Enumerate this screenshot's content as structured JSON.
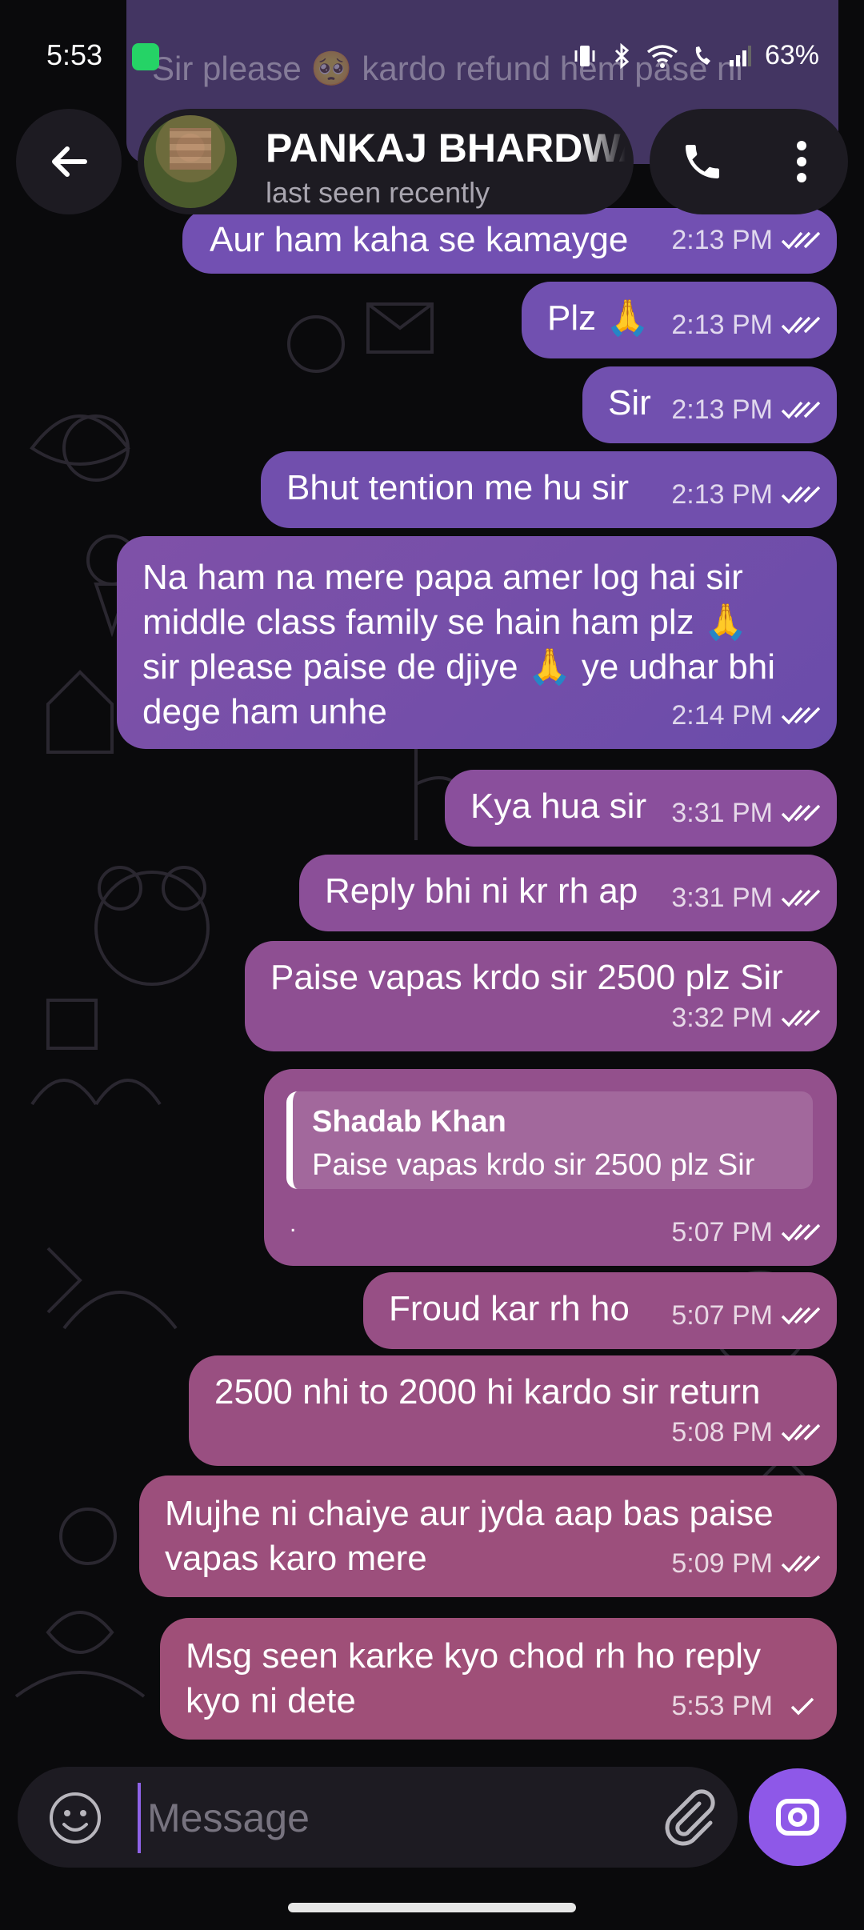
{
  "status_bar": {
    "time": "5:53",
    "battery": "63%"
  },
  "header": {
    "contact_name": "PANKAJ BHARDWAJ",
    "contact_status": "last seen recently"
  },
  "background_preview": "Sir please 🥺 kardo refund hem pase ni",
  "messages": [
    {
      "text": [
        "Aur ham kaha se kamayge"
      ],
      "time": "2:13 PM",
      "status": "read"
    },
    {
      "text": [
        "Plz 🙏"
      ],
      "time": "2:13 PM",
      "status": "read"
    },
    {
      "text": [
        "Sir"
      ],
      "time": "2:13 PM",
      "status": "read"
    },
    {
      "text": [
        "Bhut tention me hu sir"
      ],
      "time": "2:13 PM",
      "status": "read"
    },
    {
      "text": [
        "Na ham na mere papa amer log hai sir",
        "middle class family se hain ham plz 🙏",
        "sir please paise de djiye 🙏 ye udhar bhi",
        "dege ham unhe"
      ],
      "time": "2:14 PM",
      "status": "read"
    },
    {
      "text": [
        "Kya hua sir"
      ],
      "time": "3:31 PM",
      "status": "read"
    },
    {
      "text": [
        "Reply bhi ni kr rh ap"
      ],
      "time": "3:31 PM",
      "status": "read"
    },
    {
      "text": [
        "Paise vapas krdo sir 2500 plz Sir"
      ],
      "time": "3:32 PM",
      "status": "read"
    },
    {
      "reply_to": {
        "author": "Shadab Khan",
        "text": "Paise vapas krdo sir 2500 plz Sir"
      },
      "text": [
        "."
      ],
      "time": "5:07 PM",
      "status": "read"
    },
    {
      "text": [
        "Froud kar rh ho"
      ],
      "time": "5:07 PM",
      "status": "read"
    },
    {
      "text": [
        "2500 nhi to 2000 hi kardo sir return"
      ],
      "time": "5:08 PM",
      "status": "read"
    },
    {
      "text": [
        "Mujhe ni chaiye aur jyda aap bas paise",
        "vapas karo mere"
      ],
      "time": "5:09 PM",
      "status": "read"
    },
    {
      "text": [
        "Msg seen karke kyo chod rh ho reply",
        "kyo ni dete"
      ],
      "time": "5:53 PM",
      "status": "sent"
    }
  ],
  "input": {
    "placeholder": "Message"
  },
  "colors": {
    "accent": "#8e58e8",
    "bubble_top": "#6b4aa6",
    "bubble_bottom": "#a2506d"
  }
}
